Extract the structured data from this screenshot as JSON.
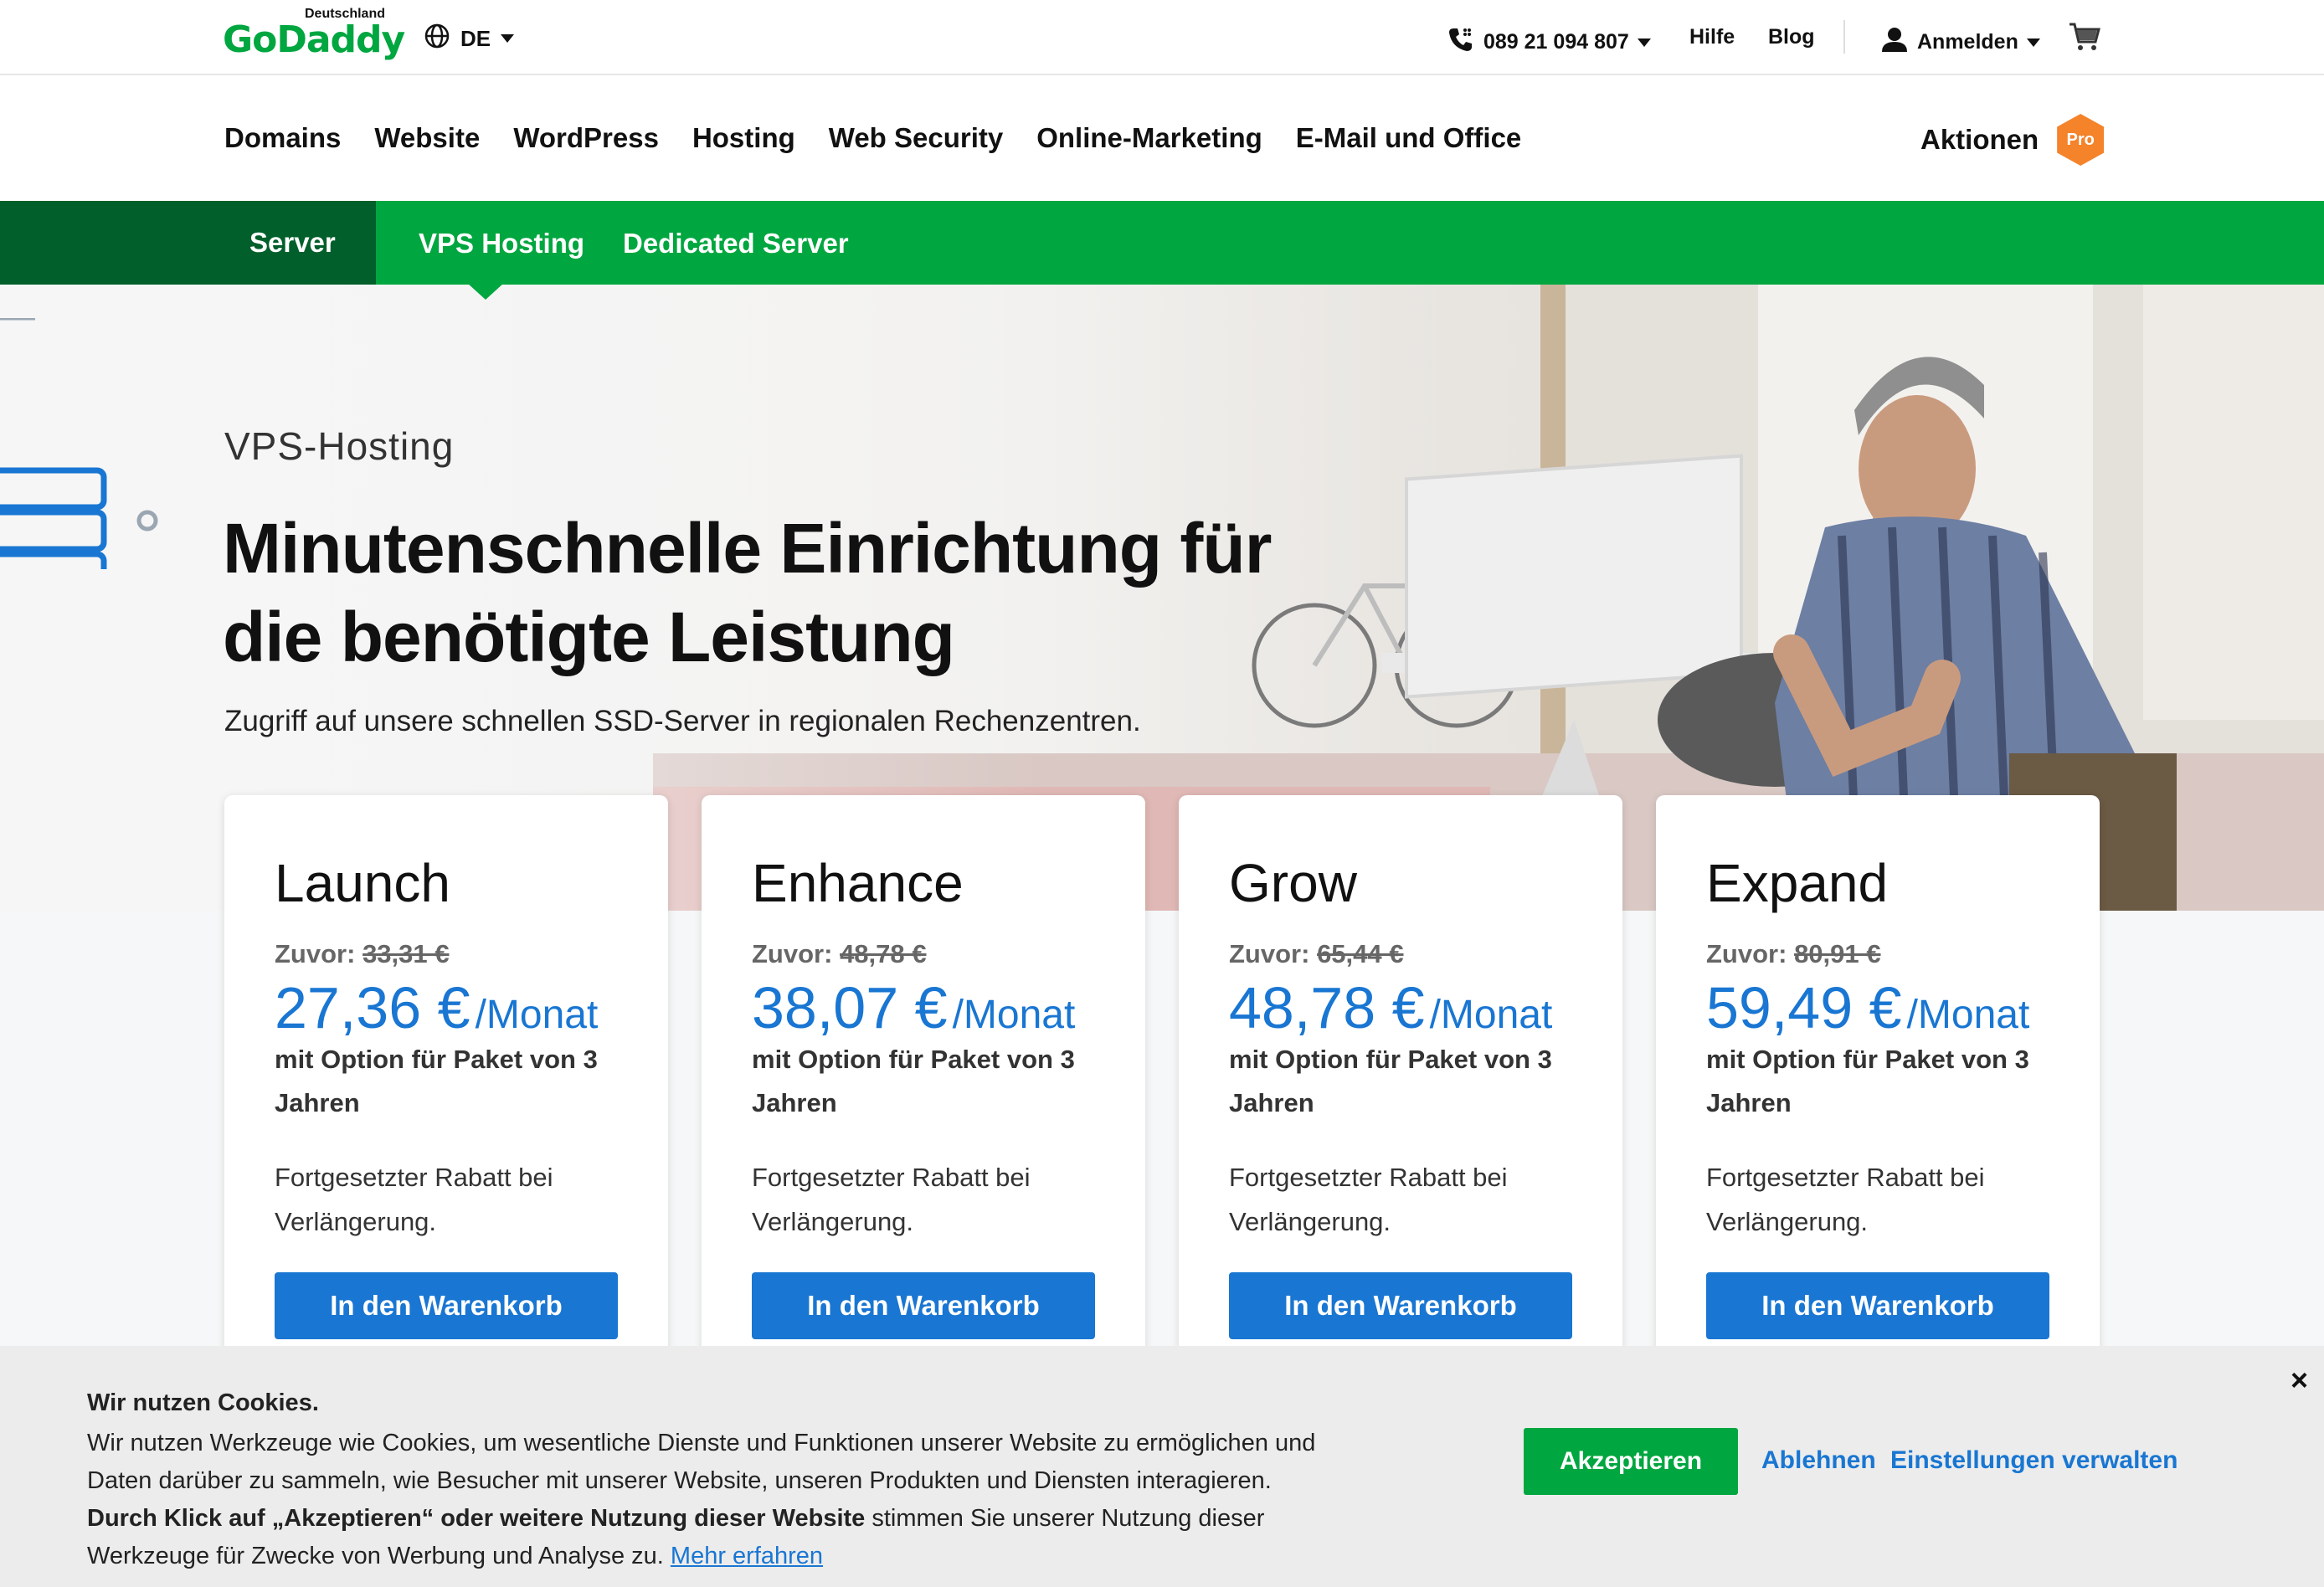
{
  "header": {
    "logo_sub": "Deutschland",
    "logo_main": "GoDaddy",
    "lang": "DE",
    "phone": "089 21 094 807",
    "help": "Hilfe",
    "blog": "Blog",
    "signin": "Anmelden"
  },
  "nav": {
    "links": [
      "Domains",
      "Website",
      "WordPress",
      "Hosting",
      "Web Security",
      "Online-Marketing",
      "E-Mail und Office"
    ],
    "promo": "Aktionen",
    "pro_badge": "Pro"
  },
  "subnav": {
    "server": "Server",
    "vps": "VPS Hosting",
    "dedicated": "Dedicated Server"
  },
  "hero": {
    "eyebrow": "VPS-Hosting",
    "title_line1": "Minutenschnelle Einrichtung für",
    "title_line2": "die benötigte Leistung",
    "subtitle": "Zugriff auf unsere schnellen SSD-Server in regionalen Rechenzentren."
  },
  "plans": [
    {
      "name": "Launch",
      "old_label": "Zuvor: ",
      "old_price": "33,31 €",
      "price": "27,36 €",
      "unit": "/Monat",
      "term": "mit Option für Paket von 3 Jahren",
      "renew": "Fortgesetzter Rabatt bei Verlängerung.",
      "cta": "In den Warenkorb"
    },
    {
      "name": "Enhance",
      "old_label": "Zuvor: ",
      "old_price": "48,78 €",
      "price": "38,07 €",
      "unit": "/Monat",
      "term": "mit Option für Paket von 3 Jahren",
      "renew": "Fortgesetzter Rabatt bei Verlängerung.",
      "cta": "In den Warenkorb"
    },
    {
      "name": "Grow",
      "old_label": "Zuvor: ",
      "old_price": "65,44 €",
      "price": "48,78 €",
      "unit": "/Monat",
      "term": "mit Option für Paket von 3 Jahren",
      "renew": "Fortgesetzter Rabatt bei Verlängerung.",
      "cta": "In den Warenkorb"
    },
    {
      "name": "Expand",
      "old_label": "Zuvor: ",
      "old_price": "80,91 €",
      "price": "59,49 €",
      "unit": "/Monat",
      "term": "mit Option für Paket von 3 Jahren",
      "renew": "Fortgesetzter Rabatt bei Verlängerung.",
      "cta": "In den Warenkorb"
    }
  ],
  "cookie": {
    "title": "Wir nutzen Cookies.",
    "text1": "Wir nutzen Werkzeuge wie Cookies, um wesentliche Dienste und Funktionen unserer Website zu ermöglichen und Daten darüber zu sammeln, wie Besucher mit unserer Website, unseren Produkten und Diensten interagieren.",
    "text_bold": "Durch Klick auf „Akzeptieren“ oder weitere Nutzung dieser Website",
    "text2": " stimmen Sie unserer Nutzung dieser Werkzeuge für Zwecke von Werbung und Analyse zu. ",
    "more": "Mehr erfahren",
    "accept": "Akzeptieren",
    "decline": "Ablehnen",
    "settings": "Einstellungen verwalten",
    "close": "×"
  },
  "colors": {
    "brand_green": "#00a63f",
    "dark_green": "#005f2a",
    "accent_blue": "#1976d2",
    "promo_orange": "#f4832a"
  },
  "icons": [
    "globe-icon",
    "phone-icon",
    "user-icon",
    "cart-icon",
    "server-rack-icon",
    "close-icon"
  ]
}
